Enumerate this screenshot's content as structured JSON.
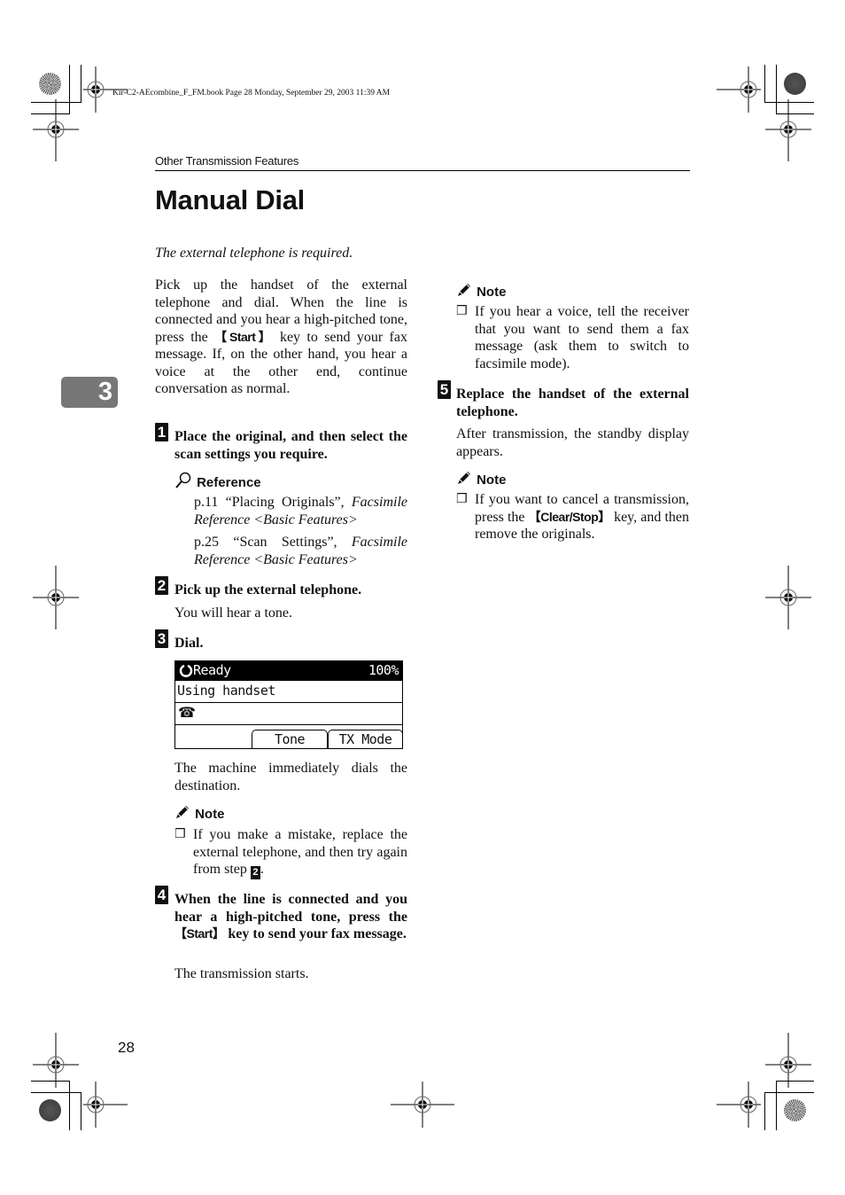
{
  "print_meta": "Kir-C2-AEcombine_F_FM.book  Page 28  Monday, September 29, 2003  11:39 AM",
  "running_head": "Other Transmission Features",
  "chapter_tab": "3",
  "title": "Manual Dial",
  "lede": "The external telephone is required.",
  "intro": {
    "before_key": "Pick up the handset of the external telephone and dial. When the line is connected and you hear a high-pitched tone, press the ",
    "key": "【Start】",
    "after_key": " key to send your fax message. If, on the other hand, you hear a voice at the other end, continue conversation as normal."
  },
  "steps": [
    {
      "number": "1",
      "heading": "Place the original, and then select the scan settings you require.",
      "reference": {
        "label": "Reference",
        "items": [
          {
            "text": "p.11 “Placing Originals”, ",
            "italic": "Facsimile Reference <Basic Features>"
          },
          {
            "text": "p.25 “Scan Settings”, ",
            "italic": "Facsimile Reference <Basic Features>"
          }
        ]
      }
    },
    {
      "number": "2",
      "heading": "Pick up the external telephone.",
      "body": "You will hear a tone."
    },
    {
      "number": "3",
      "heading": "Dial.",
      "display": {
        "status": "Ready",
        "zoom": "100%",
        "line1": "Using handset",
        "softkeys": [
          "Tone",
          "TX Mode"
        ]
      },
      "body": "The machine immediately dials the destination.",
      "note": {
        "label": "Note",
        "items": [
          {
            "text": "If you make a mistake, replace the external telephone, and then try again from step ",
            "step_ref": "2",
            "after": "."
          }
        ]
      }
    },
    {
      "number": "4",
      "heading_before_key": "When the line is connected and you hear a high-pitched tone, press the ",
      "heading_key": "【Start】",
      "heading_after_key": " key to send your fax message.",
      "body": "The transmission starts.",
      "note": {
        "label": "Note",
        "items": [
          {
            "text": "If you hear a voice, tell the receiver that you want to send them a fax message (ask them to switch to facsimile mode)."
          }
        ]
      }
    },
    {
      "number": "5",
      "heading": "Replace the handset of the external telephone.",
      "body": "After transmission, the standby display appears.",
      "note": {
        "label": "Note",
        "items": [
          {
            "before_key": "If you want to cancel a transmission, press the ",
            "key": "【Clear/Stop】",
            "after_key": " key, and then remove the originals."
          }
        ]
      }
    }
  ],
  "page_number": "28"
}
